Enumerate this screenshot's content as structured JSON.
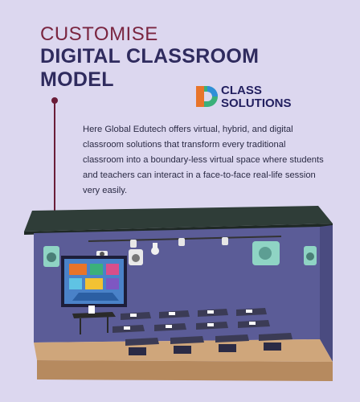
{
  "header": {
    "title_line1": "CUSTOMISE",
    "title_line2": "DIGITAL CLASSROOM MODEL"
  },
  "logo": {
    "line1": "CLASS",
    "line2": "SOLUTIONS",
    "colors": [
      "#e8742a",
      "#3bb07a",
      "#2f8fd8"
    ]
  },
  "description": "Here Global Edutech offers virtual, hybrid, and digital classroom solutions that transform every traditional classroom into a boundary-less virtual space where students and teachers can interact in a face-to-face real-life session very easily.",
  "colors": {
    "background": "#dcd7ef",
    "title_accent": "#7a2540",
    "title_main": "#2f2b5e",
    "room_wall": "#5a5b96",
    "room_floor": "#cfa67b",
    "roof": "#2f3d38"
  }
}
